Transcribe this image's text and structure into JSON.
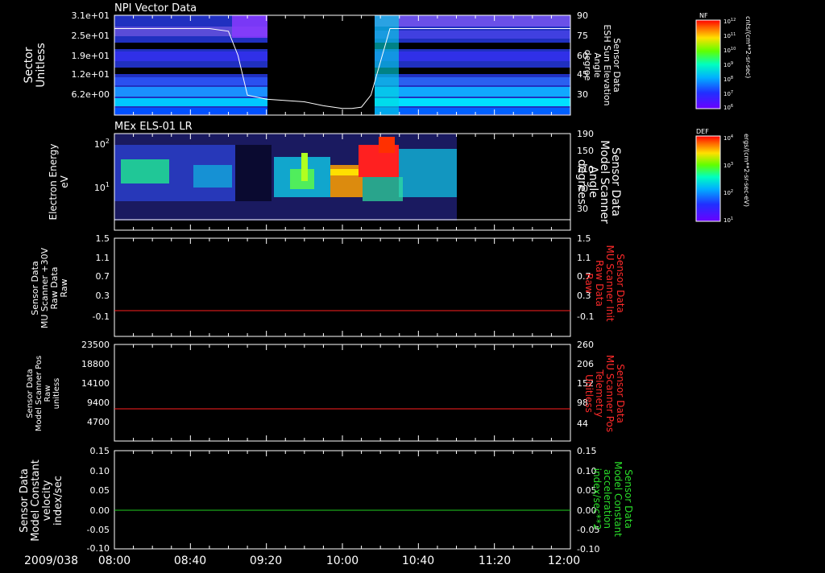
{
  "colors": {
    "background": "#000000",
    "axis": "#ffffff",
    "red_trace": "#ff2020",
    "green_trace": "#20d020",
    "red_label": "#ff2a2a",
    "green_label": "#2adf2a"
  },
  "time_axis": {
    "date_label": "2009/038",
    "ticks": [
      "08:00",
      "08:40",
      "09:20",
      "10:00",
      "10:40",
      "11:20",
      "12:00"
    ],
    "range": [
      "08:00",
      "12:00"
    ]
  },
  "panels": [
    {
      "id": "npi",
      "title": "NPI Vector Data",
      "left_label": [
        "Sector",
        "Unitless"
      ],
      "right_label": [
        "Sensor Data",
        "ESH Sun Elevation",
        "Angle",
        "degree"
      ],
      "left_ticks": [
        "3.1e+01",
        "2.5e+01",
        "1.9e+01",
        "1.2e+01",
        "6.2e+00"
      ],
      "right_ticks": [
        "90",
        "75",
        "60",
        "45",
        "30"
      ],
      "colorbar": {
        "title": "NF",
        "unit": "cnts/(cm**2-sr-sec)",
        "ticks": [
          "10^12",
          "10^11",
          "10^10",
          "10^9",
          "10^8",
          "10^7",
          "10^6"
        ]
      },
      "data_gap": [
        "09:20",
        "10:10"
      ]
    },
    {
      "id": "els",
      "title": "MEx ELS-01 LR",
      "left_label": [
        "Electron Energy",
        "eV"
      ],
      "right_label": [
        "Sensor Data",
        "Model Scanner",
        "Angle",
        "degrees"
      ],
      "left_ticks": [
        "10^2",
        "10^1"
      ],
      "right_ticks": [
        "190",
        "150",
        "110",
        "70",
        "30"
      ],
      "colorbar": {
        "title": "DEF",
        "unit": "ergs/(cm**2-sr-sec-eV)",
        "ticks": [
          "10^4",
          "10^3",
          "10^2",
          "10^1"
        ]
      },
      "data_end": "10:50"
    },
    {
      "id": "mu_raw",
      "left_label": [
        "Sensor Data",
        "MU Scanner +30V",
        "Raw Data",
        "Raw"
      ],
      "right_label": [
        "Sensor Data",
        "MU Scanner Init",
        "Raw Data",
        "Raw"
      ],
      "left_ticks": [
        "1.5",
        "1.1",
        "0.7",
        "0.3",
        "-0.1"
      ],
      "right_ticks": [
        "1.5",
        "1.1",
        "0.7",
        "0.3",
        "-0.1"
      ]
    },
    {
      "id": "scanner_pos",
      "left_label": [
        "Sensor Data",
        "Model Scanner Pos",
        "Raw",
        "unitless"
      ],
      "right_label": [
        "Sensor Data",
        "MU Scanner Pos",
        "Telemetry",
        "Unitless"
      ],
      "left_ticks": [
        "23500",
        "18800",
        "14100",
        "9400",
        "4700"
      ],
      "right_ticks": [
        "260",
        "206",
        "152",
        "98",
        "44"
      ]
    },
    {
      "id": "constant",
      "left_label": [
        "Sensor Data",
        "Model Constant",
        "velocity",
        "index/sec"
      ],
      "right_label": [
        "Sensor Data",
        "Model Constant",
        "acceleration",
        "index/sec**2"
      ],
      "left_ticks": [
        "0.15",
        "0.10",
        "0.05",
        "0.00",
        "-0.05",
        "-0.10"
      ],
      "right_ticks": [
        "0.15",
        "0.10",
        "0.05",
        "0.00",
        "-0.05",
        "-0.10"
      ]
    }
  ],
  "chart_data": [
    {
      "type": "heatmap",
      "title": "NPI Vector Data",
      "ylabel": "Sector Unitless",
      "ylim": [
        0,
        31
      ],
      "overlay_line": {
        "ylabel": "ESH Sun Elevation Angle (degree)",
        "ylim": [
          15,
          90
        ],
        "x": [
          "08:00",
          "08:50",
          "09:00",
          "09:05",
          "09:10",
          "09:20",
          "09:40",
          "09:50",
          "10:00",
          "10:05",
          "10:10",
          "10:15",
          "10:20",
          "10:25",
          "12:00"
        ],
        "y": [
          80,
          80,
          78,
          60,
          30,
          27,
          25,
          22,
          20,
          20,
          21,
          30,
          55,
          80,
          80
        ]
      }
    },
    {
      "type": "heatmap",
      "title": "MEx ELS-01 LR",
      "ylabel": "Electron Energy eV",
      "yscale": "log",
      "ylim": [
        1,
        200
      ],
      "overlay_line": {
        "ylabel": "Model Scanner Angle (degrees)",
        "ylim": [
          0,
          190
        ],
        "x": [
          "08:00",
          "12:00"
        ],
        "y": [
          1,
          1
        ]
      }
    },
    {
      "type": "line",
      "ylabel": "MU Scanner +30V Raw Data Raw",
      "ylim": [
        -0.3,
        1.5
      ],
      "series": [
        {
          "name": "MU Scanner Init Raw Data Raw",
          "x": [
            "08:00",
            "12:00"
          ],
          "y": [
            0.0,
            0.0
          ]
        }
      ]
    },
    {
      "type": "line",
      "ylabel": "Model Scanner Pos Raw unitless",
      "ylim": [
        0,
        23500
      ],
      "series": [
        {
          "name": "MU Scanner Pos Telemetry Unitless",
          "x": [
            "08:00",
            "12:00"
          ],
          "y": [
            8000,
            8000
          ]
        }
      ]
    },
    {
      "type": "line",
      "ylabel": "Model Constant velocity index/sec",
      "ylim": [
        -0.1,
        0.15
      ],
      "series": [
        {
          "name": "Model Constant acceleration index/sec**2",
          "x": [
            "08:00",
            "12:00"
          ],
          "y": [
            0.0,
            0.0
          ]
        }
      ]
    }
  ]
}
